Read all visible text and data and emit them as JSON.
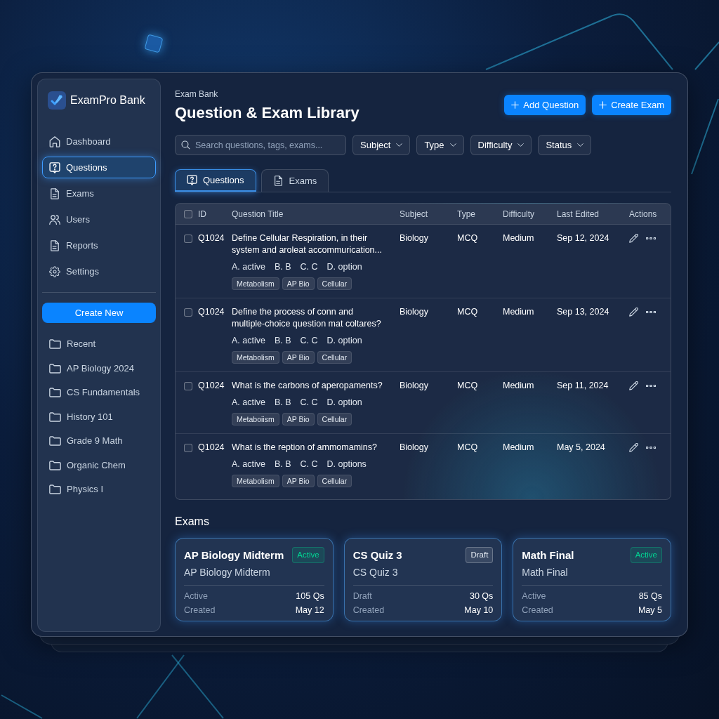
{
  "app": {
    "name": "ExamPro Bank"
  },
  "sidebar": {
    "nav": [
      {
        "label": "Dashboard",
        "selected": false
      },
      {
        "label": "Questions",
        "selected": true
      },
      {
        "label": "Exams",
        "selected": false
      },
      {
        "label": "Users",
        "selected": false
      },
      {
        "label": "Reports",
        "selected": false
      },
      {
        "label": "Settings",
        "selected": false
      }
    ],
    "create_button": "Create New",
    "folders": [
      "Recent",
      "AP Biology 2024",
      "CS Fundamentals",
      "History 101",
      "Grade 9 Math",
      "Organic Chem",
      "Physics I"
    ]
  },
  "header": {
    "breadcrumb": "Exam Bank",
    "title": "Question & Exam Library",
    "buttons": [
      "Add Question",
      "Create Exam"
    ]
  },
  "filters": {
    "search": {
      "placeholder": "Search questions, tags, exams..."
    },
    "dropdowns": [
      "Subject",
      "Type",
      "Difficulty",
      "Status"
    ]
  },
  "tabs": [
    {
      "label": "Questions",
      "selected": true
    },
    {
      "label": "Exams",
      "selected": false
    }
  ],
  "table": {
    "columns": [
      "ID",
      "Question Title",
      "Subject",
      "Type",
      "Difficulty",
      "Last Edited",
      "Actions"
    ],
    "all_checked": false,
    "rows": [
      {
        "checked": false,
        "id": "Q1024",
        "title": "Define Cellular Respiration, in their system and aroleat accommurication...",
        "options": [
          "A. active",
          "B. B",
          "C. C",
          "D. option"
        ],
        "tags": [
          "Metabolism",
          "AP Bio",
          "Cellular"
        ],
        "subject": "Biology",
        "type": "MCQ",
        "difficulty": "Medium",
        "last_edited": "Sep 12, 2024"
      },
      {
        "checked": false,
        "id": "Q1024",
        "title": "Define the process of conn and multiple-choice question mat coltares?",
        "options": [
          "A. active",
          "B. B",
          "C. C",
          "D. option"
        ],
        "tags": [
          "Metabolism",
          "AP Bio",
          "Cellular"
        ],
        "subject": "Biology",
        "type": "MCQ",
        "difficulty": "Medium",
        "last_edited": "Sep 13, 2024"
      },
      {
        "checked": false,
        "id": "Q1024",
        "title": "What is the carbons of aperopaments?",
        "options": [
          "A. active",
          "B. B",
          "C. C",
          "D. option"
        ],
        "tags": [
          "Metaboiism",
          "AP Bio",
          "Cellular"
        ],
        "subject": "Biology",
        "type": "MCQ",
        "difficulty": "Medium",
        "last_edited": "Sep 11, 2024"
      },
      {
        "checked": false,
        "id": "Q1024",
        "title": "What is the reption of ammomamins?",
        "options": [
          "A. active",
          "B. B",
          "C. C",
          "D. options"
        ],
        "tags": [
          "Metabolism",
          "AP Bio",
          "Cellular"
        ],
        "subject": "Biology",
        "type": "MCQ",
        "difficulty": "Medium",
        "last_edited": "May 5, 2024"
      }
    ]
  },
  "exams": {
    "heading": "Exams",
    "cards": [
      {
        "title": "AP Biology Midterm",
        "subtitle": "AP Biology Midterm",
        "badge": {
          "label": "Active",
          "kind": "active"
        },
        "status": "Active",
        "count": "105 Qs",
        "created_label": "Created",
        "created": "May 12"
      },
      {
        "title": "CS Quiz 3",
        "subtitle": "CS Quiz 3",
        "badge": {
          "label": "Draft",
          "kind": "draft"
        },
        "status": "Draft",
        "count": "30 Qs",
        "created_label": "Created",
        "created": "May 10"
      },
      {
        "title": "Math Final",
        "subtitle": "Math Final",
        "badge": {
          "label": "Active",
          "kind": "active"
        },
        "status": "Active",
        "count": "85 Qs",
        "created_label": "Created",
        "created": "May 5"
      }
    ]
  }
}
